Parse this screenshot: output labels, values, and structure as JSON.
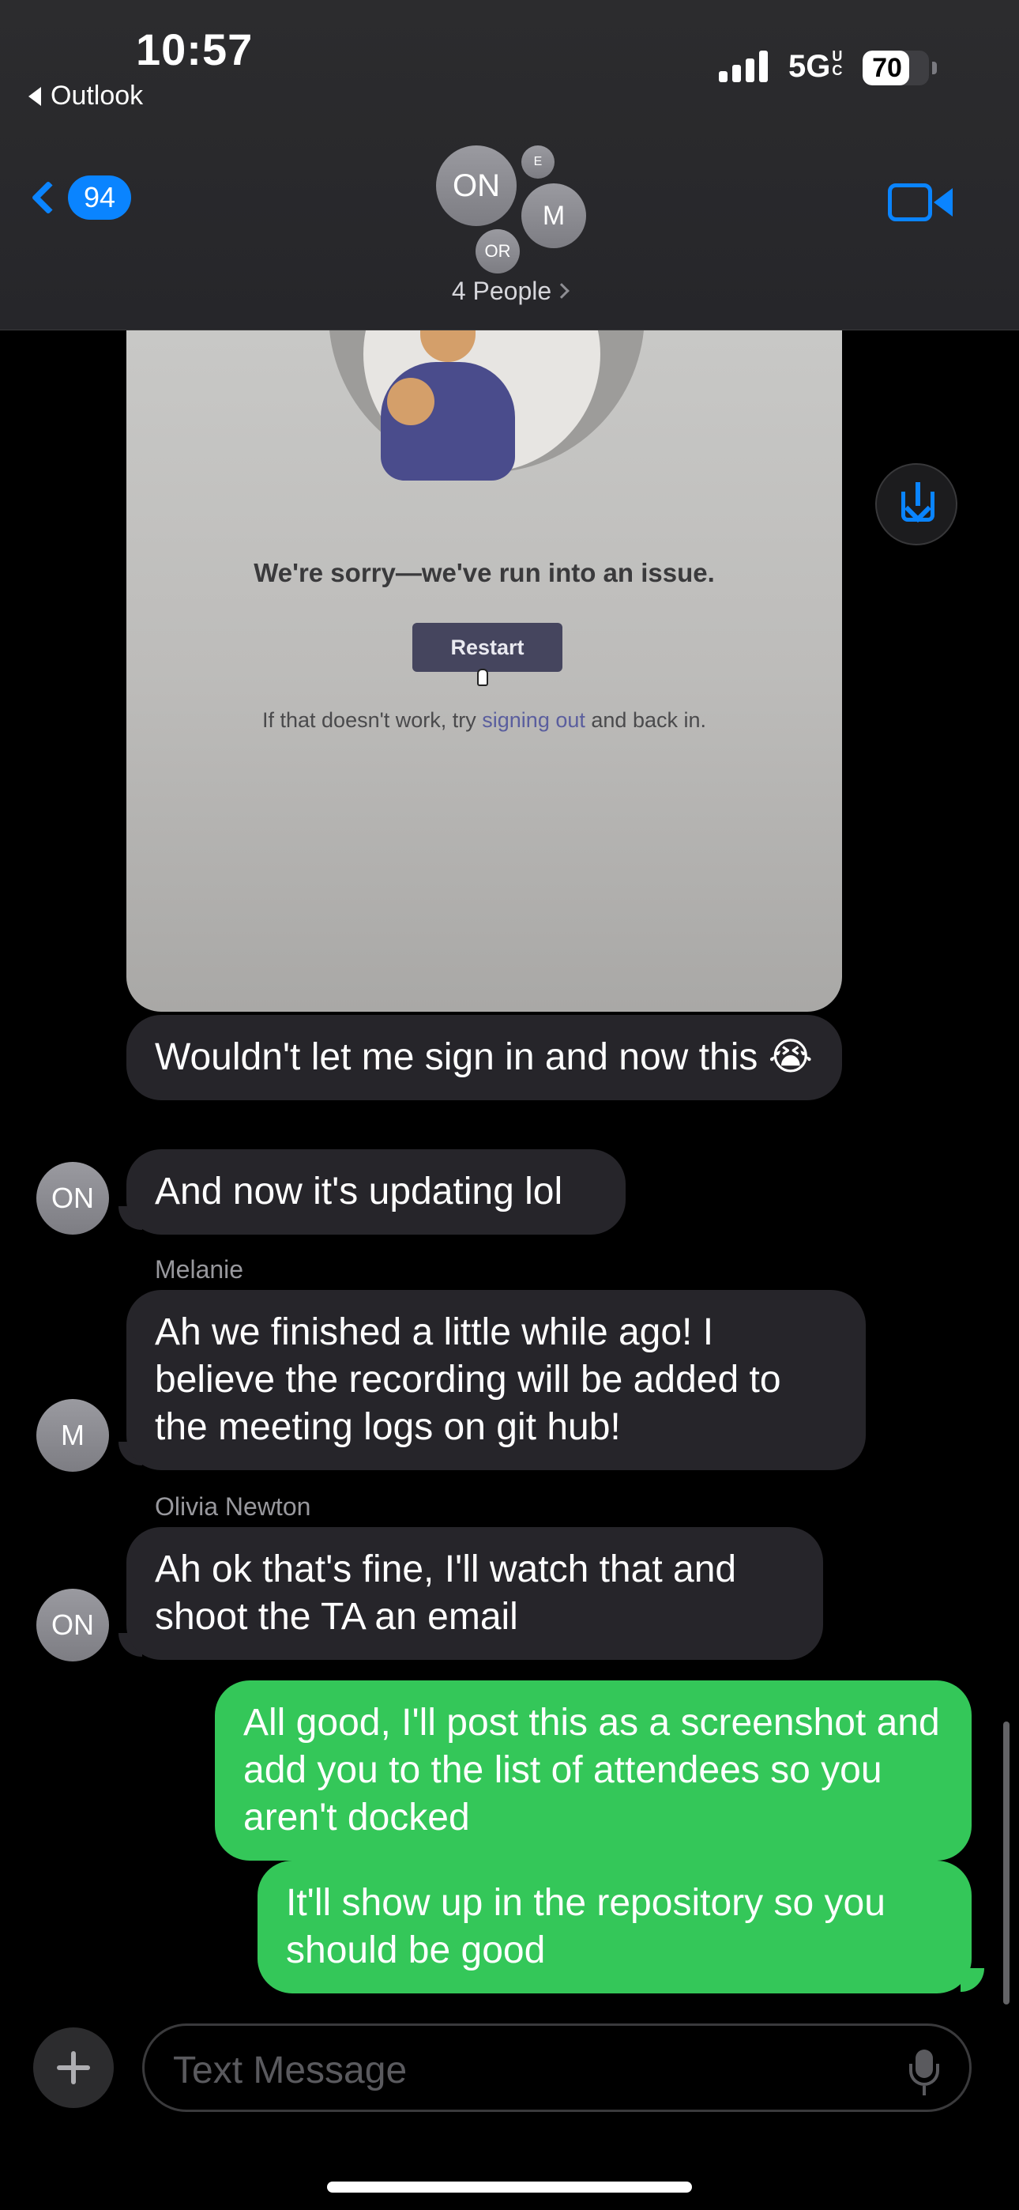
{
  "status_bar": {
    "time": "10:57",
    "back_app": "Outlook",
    "network": "5G",
    "network_sup": "U",
    "network_sub": "C",
    "battery": "70",
    "battery_level": 0.7
  },
  "header": {
    "unread_count": "94",
    "people_label": "4 People",
    "avatars": {
      "primary": "ON",
      "small_top": "E",
      "secondary": "M",
      "small_bottom": "OR"
    },
    "accent_color": "#0a84ff"
  },
  "image_message": {
    "headline": "We're sorry—we've run into an issue.",
    "button_label": "Restart",
    "hint_before": "If that doesn't work, try ",
    "hint_link": "signing out",
    "hint_after": " and back in."
  },
  "messages": [
    {
      "direction": "incoming",
      "text": "Wouldn't let me sign in and now this 😭"
    },
    {
      "direction": "incoming",
      "avatar": "ON",
      "text": "And now it's updating lol"
    },
    {
      "direction": "incoming",
      "sender": "Melanie",
      "avatar": "M",
      "text": "Ah we finished a little while ago! I believe the recording will be added to the meeting logs on git hub!"
    },
    {
      "direction": "incoming",
      "sender": "Olivia Newton",
      "avatar": "ON",
      "text": "Ah ok that's fine, I'll watch that and shoot the TA an email"
    },
    {
      "direction": "outgoing",
      "text": "All good, I'll post this as a screenshot and add you to the list of attendees so you aren't docked"
    },
    {
      "direction": "outgoing",
      "text": "It'll show up in the repository so you should be good"
    }
  ],
  "composer": {
    "placeholder": "Text Message",
    "add_icon": "plus-icon",
    "mic_icon": "microphone-icon"
  },
  "colors": {
    "incoming_bubble": "#26252a",
    "outgoing_bubble": "#34c759",
    "background": "#000000"
  }
}
